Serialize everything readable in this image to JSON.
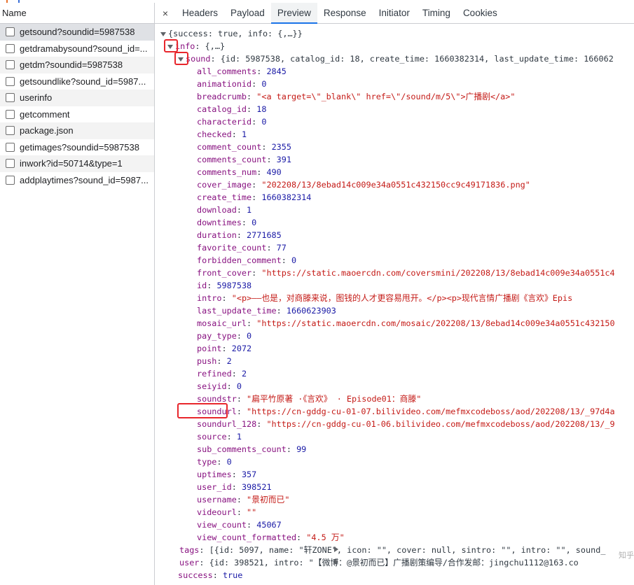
{
  "network": {
    "name_header": "Name",
    "requests": [
      {
        "name": "getsound?soundid=5987538",
        "selected": true
      },
      {
        "name": "getdramabysound?sound_id=..."
      },
      {
        "name": "getdm?soundid=5987538"
      },
      {
        "name": "getsoundlike?sound_id=5987..."
      },
      {
        "name": "userinfo"
      },
      {
        "name": "getcomment"
      },
      {
        "name": "package.json"
      },
      {
        "name": "getimages?soundid=5987538"
      },
      {
        "name": "inwork?id=50714&type=1"
      },
      {
        "name": "addplaytimes?sound_id=5987..."
      }
    ]
  },
  "tabs": {
    "close": "×",
    "items": [
      "Headers",
      "Payload",
      "Preview",
      "Response",
      "Initiator",
      "Timing",
      "Cookies"
    ],
    "active": "Preview"
  },
  "preview": {
    "root_summary": "{success: true, info: {,…}}",
    "info_summary": "{,…}",
    "sound_summary": "{id: 5987538, catalog_id: 18, create_time: 1660382314, last_update_time: 166062",
    "fields": [
      {
        "k": "all_comments",
        "v": "2845",
        "t": "num"
      },
      {
        "k": "animationid",
        "v": "0",
        "t": "num"
      },
      {
        "k": "breadcrumb",
        "v": "\"<a target=\\\"_blank\\\" href=\\\"/sound/m/5\\\">广播剧</a>\"",
        "t": "str"
      },
      {
        "k": "catalog_id",
        "v": "18",
        "t": "num"
      },
      {
        "k": "characterid",
        "v": "0",
        "t": "num"
      },
      {
        "k": "checked",
        "v": "1",
        "t": "num"
      },
      {
        "k": "comment_count",
        "v": "2355",
        "t": "num"
      },
      {
        "k": "comments_count",
        "v": "391",
        "t": "num"
      },
      {
        "k": "comments_num",
        "v": "490",
        "t": "num"
      },
      {
        "k": "cover_image",
        "v": "\"202208/13/8ebad14c009e34a0551c432150cc9c49171836.png\"",
        "t": "str"
      },
      {
        "k": "create_time",
        "v": "1660382314",
        "t": "num"
      },
      {
        "k": "download",
        "v": "1",
        "t": "num"
      },
      {
        "k": "downtimes",
        "v": "0",
        "t": "num"
      },
      {
        "k": "duration",
        "v": "2771685",
        "t": "num"
      },
      {
        "k": "favorite_count",
        "v": "77",
        "t": "num"
      },
      {
        "k": "forbidden_comment",
        "v": "0",
        "t": "num"
      },
      {
        "k": "front_cover",
        "v": "\"https://static.maoercdn.com/coversmini/202208/13/8ebad14c009e34a0551c4",
        "t": "str"
      },
      {
        "k": "id",
        "v": "5987538",
        "t": "num"
      },
      {
        "k": "intro",
        "v": "\"<p>——也是，对商滕来说，图钱的人才更容易甩开。</p><p>现代言情广播剧《言欢》Epis",
        "t": "str"
      },
      {
        "k": "last_update_time",
        "v": "1660623903",
        "t": "num"
      },
      {
        "k": "mosaic_url",
        "v": "\"https://static.maoercdn.com/mosaic/202208/13/8ebad14c009e34a0551c432150",
        "t": "str"
      },
      {
        "k": "pay_type",
        "v": "0",
        "t": "num"
      },
      {
        "k": "point",
        "v": "2072",
        "t": "num"
      },
      {
        "k": "push",
        "v": "2",
        "t": "num"
      },
      {
        "k": "refined",
        "v": "2",
        "t": "num"
      },
      {
        "k": "seiyid",
        "v": "0",
        "t": "num"
      },
      {
        "k": "soundstr",
        "v": "\"扁平竹原著 ·《言欢》 · Episode01：商滕\"",
        "t": "str"
      },
      {
        "k": "soundurl",
        "v": "\"https://cn-gddg-cu-01-07.bilivideo.com/mefmxcodeboss/aod/202208/13/_97d4a",
        "t": "str",
        "highlight": true
      },
      {
        "k": "soundurl_128",
        "v": "\"https://cn-gddg-cu-01-06.bilivideo.com/mefmxcodeboss/aod/202208/13/_9",
        "t": "str"
      },
      {
        "k": "source",
        "v": "1",
        "t": "num"
      },
      {
        "k": "sub_comments_count",
        "v": "99",
        "t": "num"
      },
      {
        "k": "type",
        "v": "0",
        "t": "num"
      },
      {
        "k": "uptimes",
        "v": "357",
        "t": "num"
      },
      {
        "k": "user_id",
        "v": "398521",
        "t": "num"
      },
      {
        "k": "username",
        "v": "\"景初而已\"",
        "t": "str"
      },
      {
        "k": "videourl",
        "v": "\"\"",
        "t": "str"
      },
      {
        "k": "view_count",
        "v": "45067",
        "t": "num"
      },
      {
        "k": "view_count_formatted",
        "v": "\"4.5 万\"",
        "t": "str"
      }
    ],
    "tags_summary": "[{id: 5097, name: \"轩ZONE\", icon: \"\", cover: null, sintro: \"\", intro: \"\", sound_",
    "user_summary": "{id: 398521, intro: \"【微博：@景初而已】广播剧策编导/合作发邮：jingchu1112@163.co",
    "success_value": "true"
  },
  "watermark": "知乎"
}
